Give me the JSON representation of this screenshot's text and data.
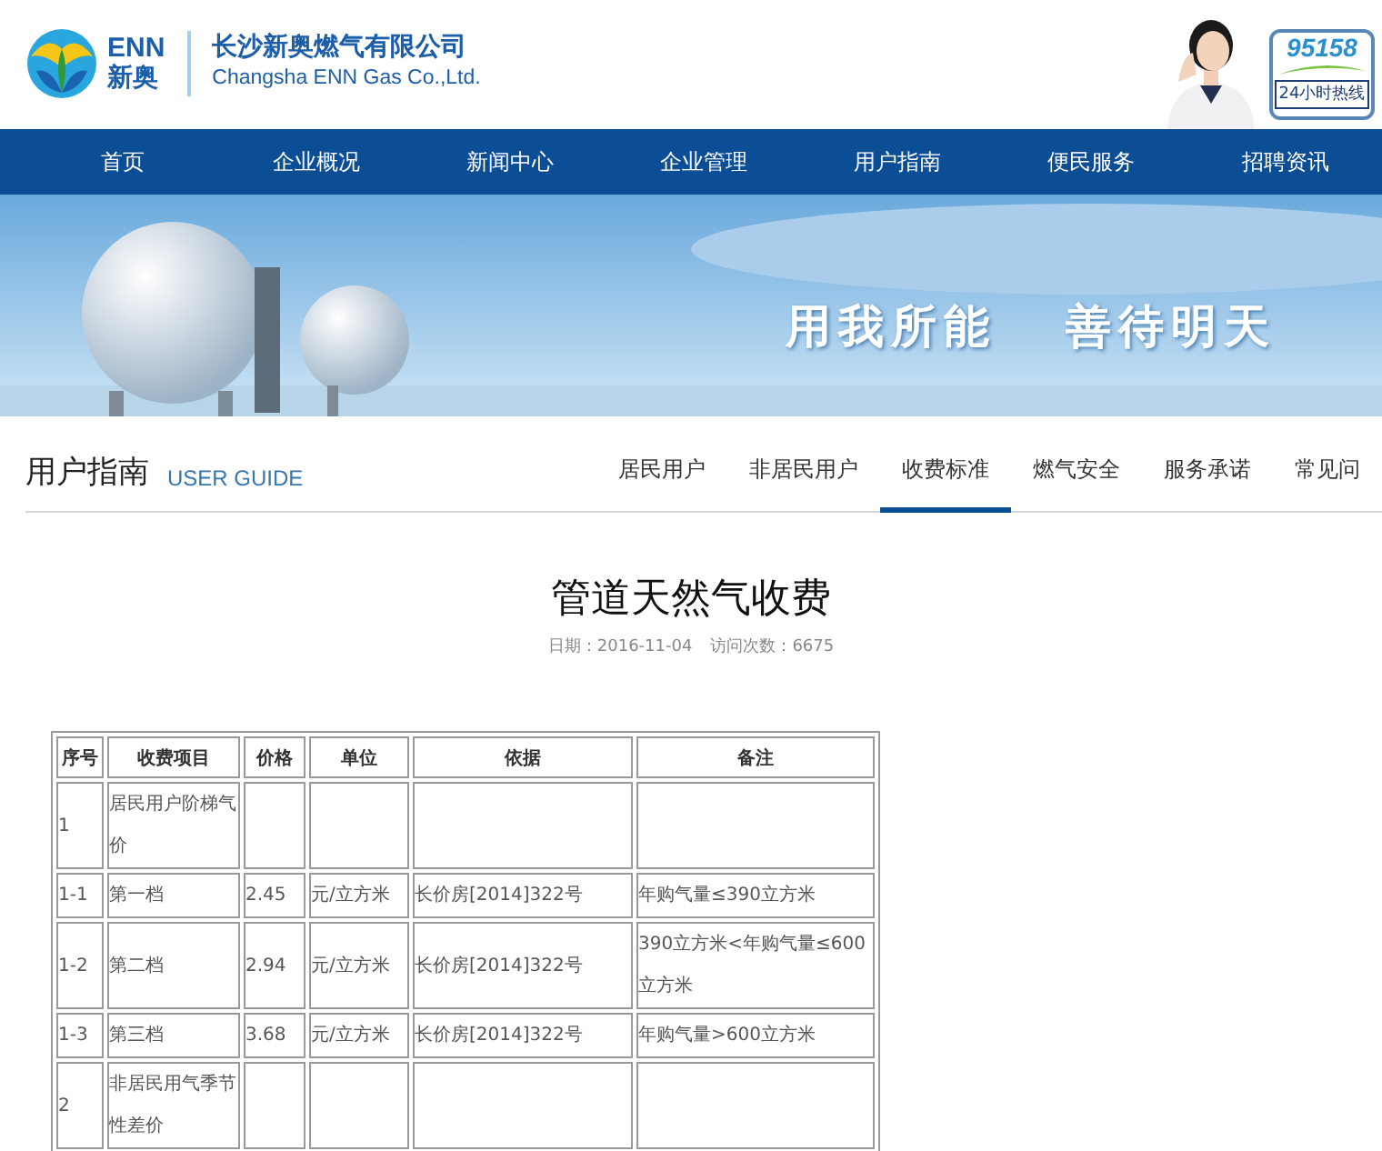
{
  "logo": {
    "brand": "ENN",
    "brand_cn": "新奥"
  },
  "company": {
    "name_cn": "长沙新奥燃气有限公司",
    "name_en": "Changsha ENN Gas Co.,Ltd."
  },
  "hotline": {
    "number": "95158",
    "label": "24小时热线"
  },
  "nav": [
    "首页",
    "企业概况",
    "新闻中心",
    "企业管理",
    "用户指南",
    "便民服务",
    "招聘资讯"
  ],
  "banner": {
    "slogan": [
      "用我所能",
      "善待明天"
    ]
  },
  "section": {
    "title": "用户指南",
    "subtitle": "USER GUIDE",
    "tabs": [
      {
        "label": "居民用户",
        "selected": false
      },
      {
        "label": "非居民用户",
        "selected": false
      },
      {
        "label": "收费标准",
        "selected": true
      },
      {
        "label": "燃气安全",
        "selected": false
      },
      {
        "label": "服务承诺",
        "selected": false
      },
      {
        "label": "常见问",
        "selected": false
      }
    ]
  },
  "article": {
    "title": "管道天然气收费",
    "date": "日期：2016-11-04",
    "visits": "访问次数：6675"
  },
  "table": {
    "columns": [
      "序号",
      "收费项目",
      "价格",
      "单位",
      "依据",
      "备注"
    ],
    "rows": [
      [
        "1",
        "居民用户阶梯气价",
        "",
        "",
        "",
        ""
      ],
      [
        "1-1",
        "第一档",
        "2.45",
        "元/立方米",
        "长价房[2014]322号",
        "年购气量≤390立方米"
      ],
      [
        "1-2",
        "第二档",
        "2.94",
        "元/立方米",
        "长价房[2014]322号",
        "390立方米<年购气量≤600立方米"
      ],
      [
        "1-3",
        "第三档",
        "3.68",
        "元/立方米",
        "长价房[2014]322号",
        "年购气量>600立方米"
      ],
      [
        "2",
        "非居民用气季节性差价",
        "",
        "",
        "",
        ""
      ]
    ]
  }
}
